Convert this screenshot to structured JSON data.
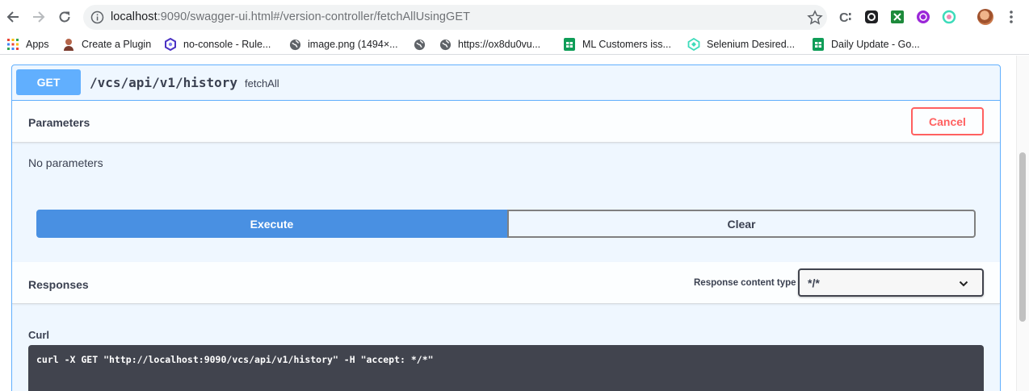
{
  "browser": {
    "url_host": "localhost",
    "url_rest": ":9090/swagger-ui.html#/version-controller/fetchAllUsingGET",
    "bookmarks": [
      {
        "label": "Apps",
        "icon": "apps-grid-icon"
      },
      {
        "label": "Create a Plugin",
        "icon": "person-icon"
      },
      {
        "label": "no-console - Rule...",
        "icon": "eslint-icon"
      },
      {
        "label": "image.png (1494×...",
        "icon": "globe-icon"
      },
      {
        "label": "",
        "icon": "globe-icon"
      },
      {
        "label": "https://ox8du0vu...",
        "icon": "globe-icon"
      },
      {
        "label": "ML Customers iss...",
        "icon": "sheets-icon"
      },
      {
        "label": "Selenium Desired...",
        "icon": "sauce-icon"
      },
      {
        "label": "Daily Update - Go...",
        "icon": "sheets-icon"
      }
    ],
    "more_label": "»",
    "colors": {
      "sheets": "#0f9d58",
      "sauce": "#3ddbba",
      "eslint": "#4b32c3"
    }
  },
  "operation": {
    "method": "GET",
    "path": "/vcs/api/v1/history",
    "summary": "fetchAll",
    "colors": {
      "method": "#61affe",
      "execute": "#4990e2",
      "cancel": "#ff6060",
      "curl_bg": "#41444e"
    }
  },
  "parameters": {
    "title": "Parameters",
    "cancel_label": "Cancel",
    "empty_text": "No parameters"
  },
  "actions": {
    "execute_label": "Execute",
    "clear_label": "Clear"
  },
  "responses": {
    "title": "Responses",
    "content_type_label": "Response content type",
    "content_type_value": "*/*"
  },
  "curl": {
    "label": "Curl",
    "command": "curl -X GET \"http://localhost:9090/vcs/api/v1/history\" -H \"accept: */*\""
  }
}
